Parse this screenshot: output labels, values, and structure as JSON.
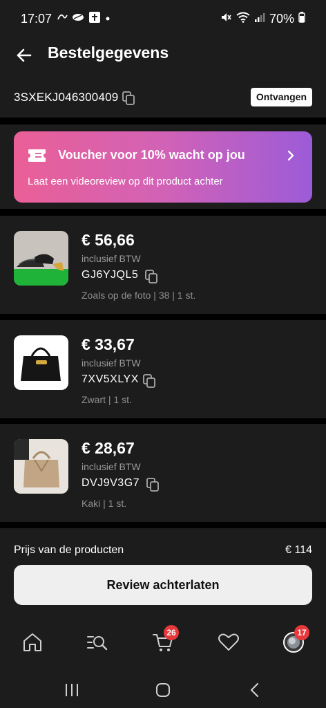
{
  "status_bar": {
    "time": "17:07",
    "battery": "70%"
  },
  "header": {
    "title": "Bestelgegevens"
  },
  "order": {
    "number": "3SXEKJ046300409",
    "status": "Ontvangen"
  },
  "voucher": {
    "title": "Voucher voor 10% wacht op jou",
    "subtitle": "Laat een videoreview op dit product achter"
  },
  "products": [
    {
      "price": "€ 56,66",
      "vat": "inclusief BTW",
      "sku": "GJ6YJQL5",
      "variant": "Zoals op de foto | 38 | 1 st."
    },
    {
      "price": "€ 33,67",
      "vat": "inclusief BTW",
      "sku": "7XV5XLYX",
      "variant": "Zwart | 1 st."
    },
    {
      "price": "€ 28,67",
      "vat": "inclusief BTW",
      "sku": "DVJ9V3G7",
      "variant": "Kaki | 1 st."
    }
  ],
  "summary": {
    "label": "Prijs van de producten",
    "value": "€ 114",
    "button": "Review achterlaten"
  },
  "bottom_nav": {
    "items": [
      {
        "icon": "home-icon"
      },
      {
        "icon": "catalog-search-icon"
      },
      {
        "icon": "cart-icon",
        "badge": "26"
      },
      {
        "icon": "heart-icon"
      },
      {
        "icon": "profile-avatar",
        "badge": "17"
      }
    ]
  },
  "colors": {
    "background": "#1c1c1c",
    "separator": "#000000",
    "voucher_gradient_start": "#ea5f97",
    "voucher_gradient_end": "#9c5bd8",
    "badge_red": "#e5383b"
  }
}
